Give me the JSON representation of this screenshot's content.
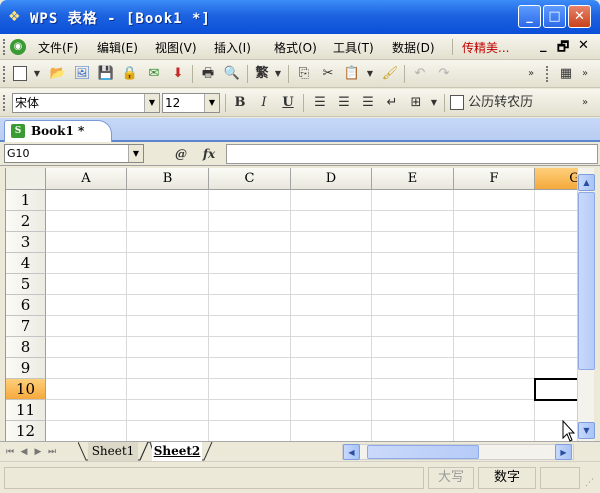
{
  "window": {
    "title": "WPS 表格 - [Book1 *]",
    "buttons": {
      "minimize": "_",
      "maximize": "□",
      "close": "✕"
    }
  },
  "menubar": {
    "items": [
      "文件(F)",
      "编辑(E)",
      "视图(V)",
      "插入(I)",
      "格式(O)",
      "工具(T)",
      "数据(D)"
    ],
    "special": "传精美...",
    "doc_minimize": "_",
    "doc_restore": "🗗",
    "doc_close": "✕"
  },
  "standard_toolbar": {
    "traditional_label": "繁"
  },
  "format_toolbar": {
    "font_name": "宋体",
    "font_size": "12",
    "bold": "B",
    "italic": "I",
    "underline": "U",
    "calendar_label": "公历转农历"
  },
  "workbook_tab": {
    "label": "Book1 *"
  },
  "formula_bar": {
    "name_box": "G10",
    "fx_label": "fx",
    "search_label": "@",
    "formula_value": ""
  },
  "grid": {
    "columns": [
      "A",
      "B",
      "C",
      "D",
      "E",
      "F",
      "G"
    ],
    "rows": [
      "1",
      "2",
      "3",
      "4",
      "5",
      "6",
      "7",
      "8",
      "9",
      "10",
      "11",
      "12"
    ],
    "active_column": "G",
    "active_row": "10",
    "selected_cell": "G10"
  },
  "sheets": {
    "tabs": [
      "Sheet1",
      "Sheet2"
    ],
    "active": "Sheet2"
  },
  "statusbar": {
    "caps": "大写",
    "num": "数字"
  },
  "colors": {
    "titlebar": "#1d63e0",
    "active_header": "#f5a93d",
    "menu_special": "#c00000"
  }
}
